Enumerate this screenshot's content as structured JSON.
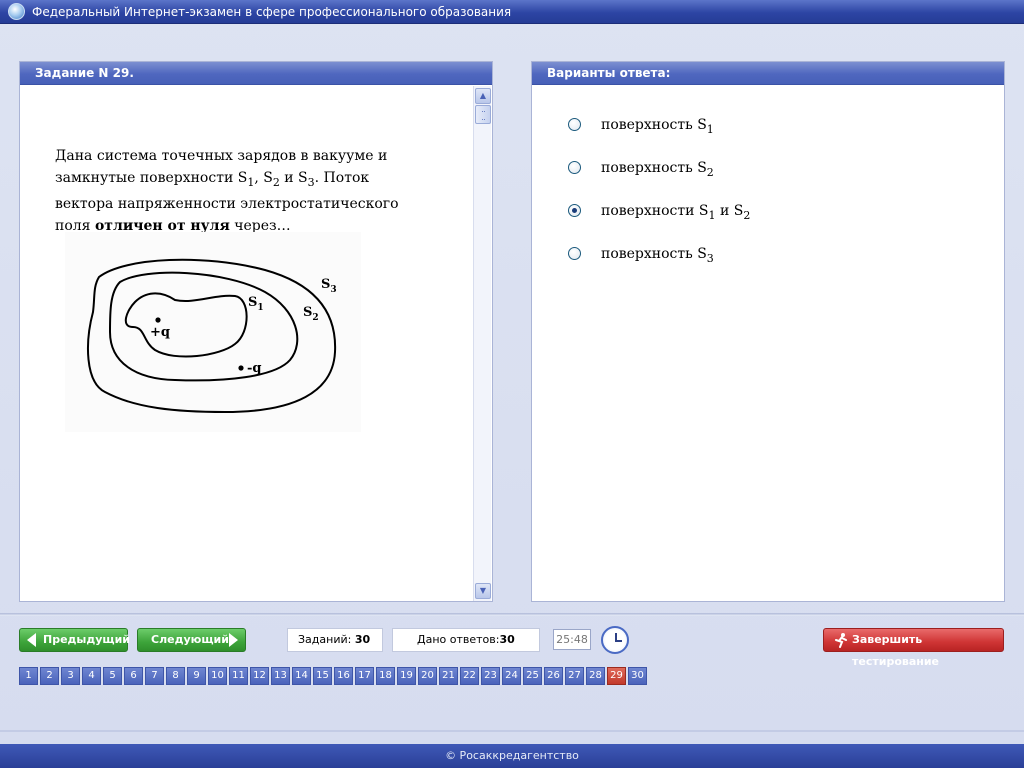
{
  "window": {
    "title": "Федеральный Интернет-экзамен в сфере профессионального образования",
    "icon": "globe-icon"
  },
  "task_panel": {
    "header": "Задание N 29.",
    "question": {
      "line1": "Дана система точечных зарядов в вакууме и",
      "line2_a": "замкнутые поверхности S",
      "line2_sub1": "1",
      "line2_b": ", S",
      "line2_sub2": "2",
      "line2_c": " и S",
      "line2_sub3": "3",
      "line2_d": ". Поток",
      "line3": "вектора напряженности электростатического",
      "line4_a": "поля ",
      "line4_bold": "отличен от нуля",
      "line4_b": " через…"
    },
    "figure": {
      "label_s1": "S",
      "label_s1_sub": "1",
      "label_s2": "S",
      "label_s2_sub": "2",
      "label_s3": "S",
      "label_s3_sub": "3",
      "charge_pos": "+q",
      "charge_neg": "-q"
    }
  },
  "answer_panel": {
    "header": "Варианты ответа:",
    "options": [
      {
        "text": "поверхность S",
        "sub": "1",
        "selected": false
      },
      {
        "text": "поверхность S",
        "sub": "2",
        "selected": false
      },
      {
        "text": "поверхности S",
        "sub": "1",
        "text2": " и S",
        "sub2": "2",
        "selected": true
      },
      {
        "text": "поверхность S",
        "sub": "3",
        "selected": false
      }
    ]
  },
  "controls": {
    "prev_label": "Предыдущий",
    "next_label": "Следующий",
    "tasks_label": "Заданий:",
    "tasks_count": "30",
    "answered_label": "Дано ответов:",
    "answered_count": "30",
    "timer": "25:48",
    "finish_label": "Завершить тестирование"
  },
  "pages": [
    "1",
    "2",
    "3",
    "4",
    "5",
    "6",
    "7",
    "8",
    "9",
    "10",
    "11",
    "12",
    "13",
    "14",
    "15",
    "16",
    "17",
    "18",
    "19",
    "20",
    "21",
    "22",
    "23",
    "24",
    "25",
    "26",
    "27",
    "28",
    "29",
    "30"
  ],
  "current_page": "29",
  "footer": "© Росаккредагентство",
  "colors": {
    "header_blue": "#4f67bf",
    "green_button": "#3da43a",
    "red_button": "#cf3434",
    "current_page": "#c2392b"
  }
}
